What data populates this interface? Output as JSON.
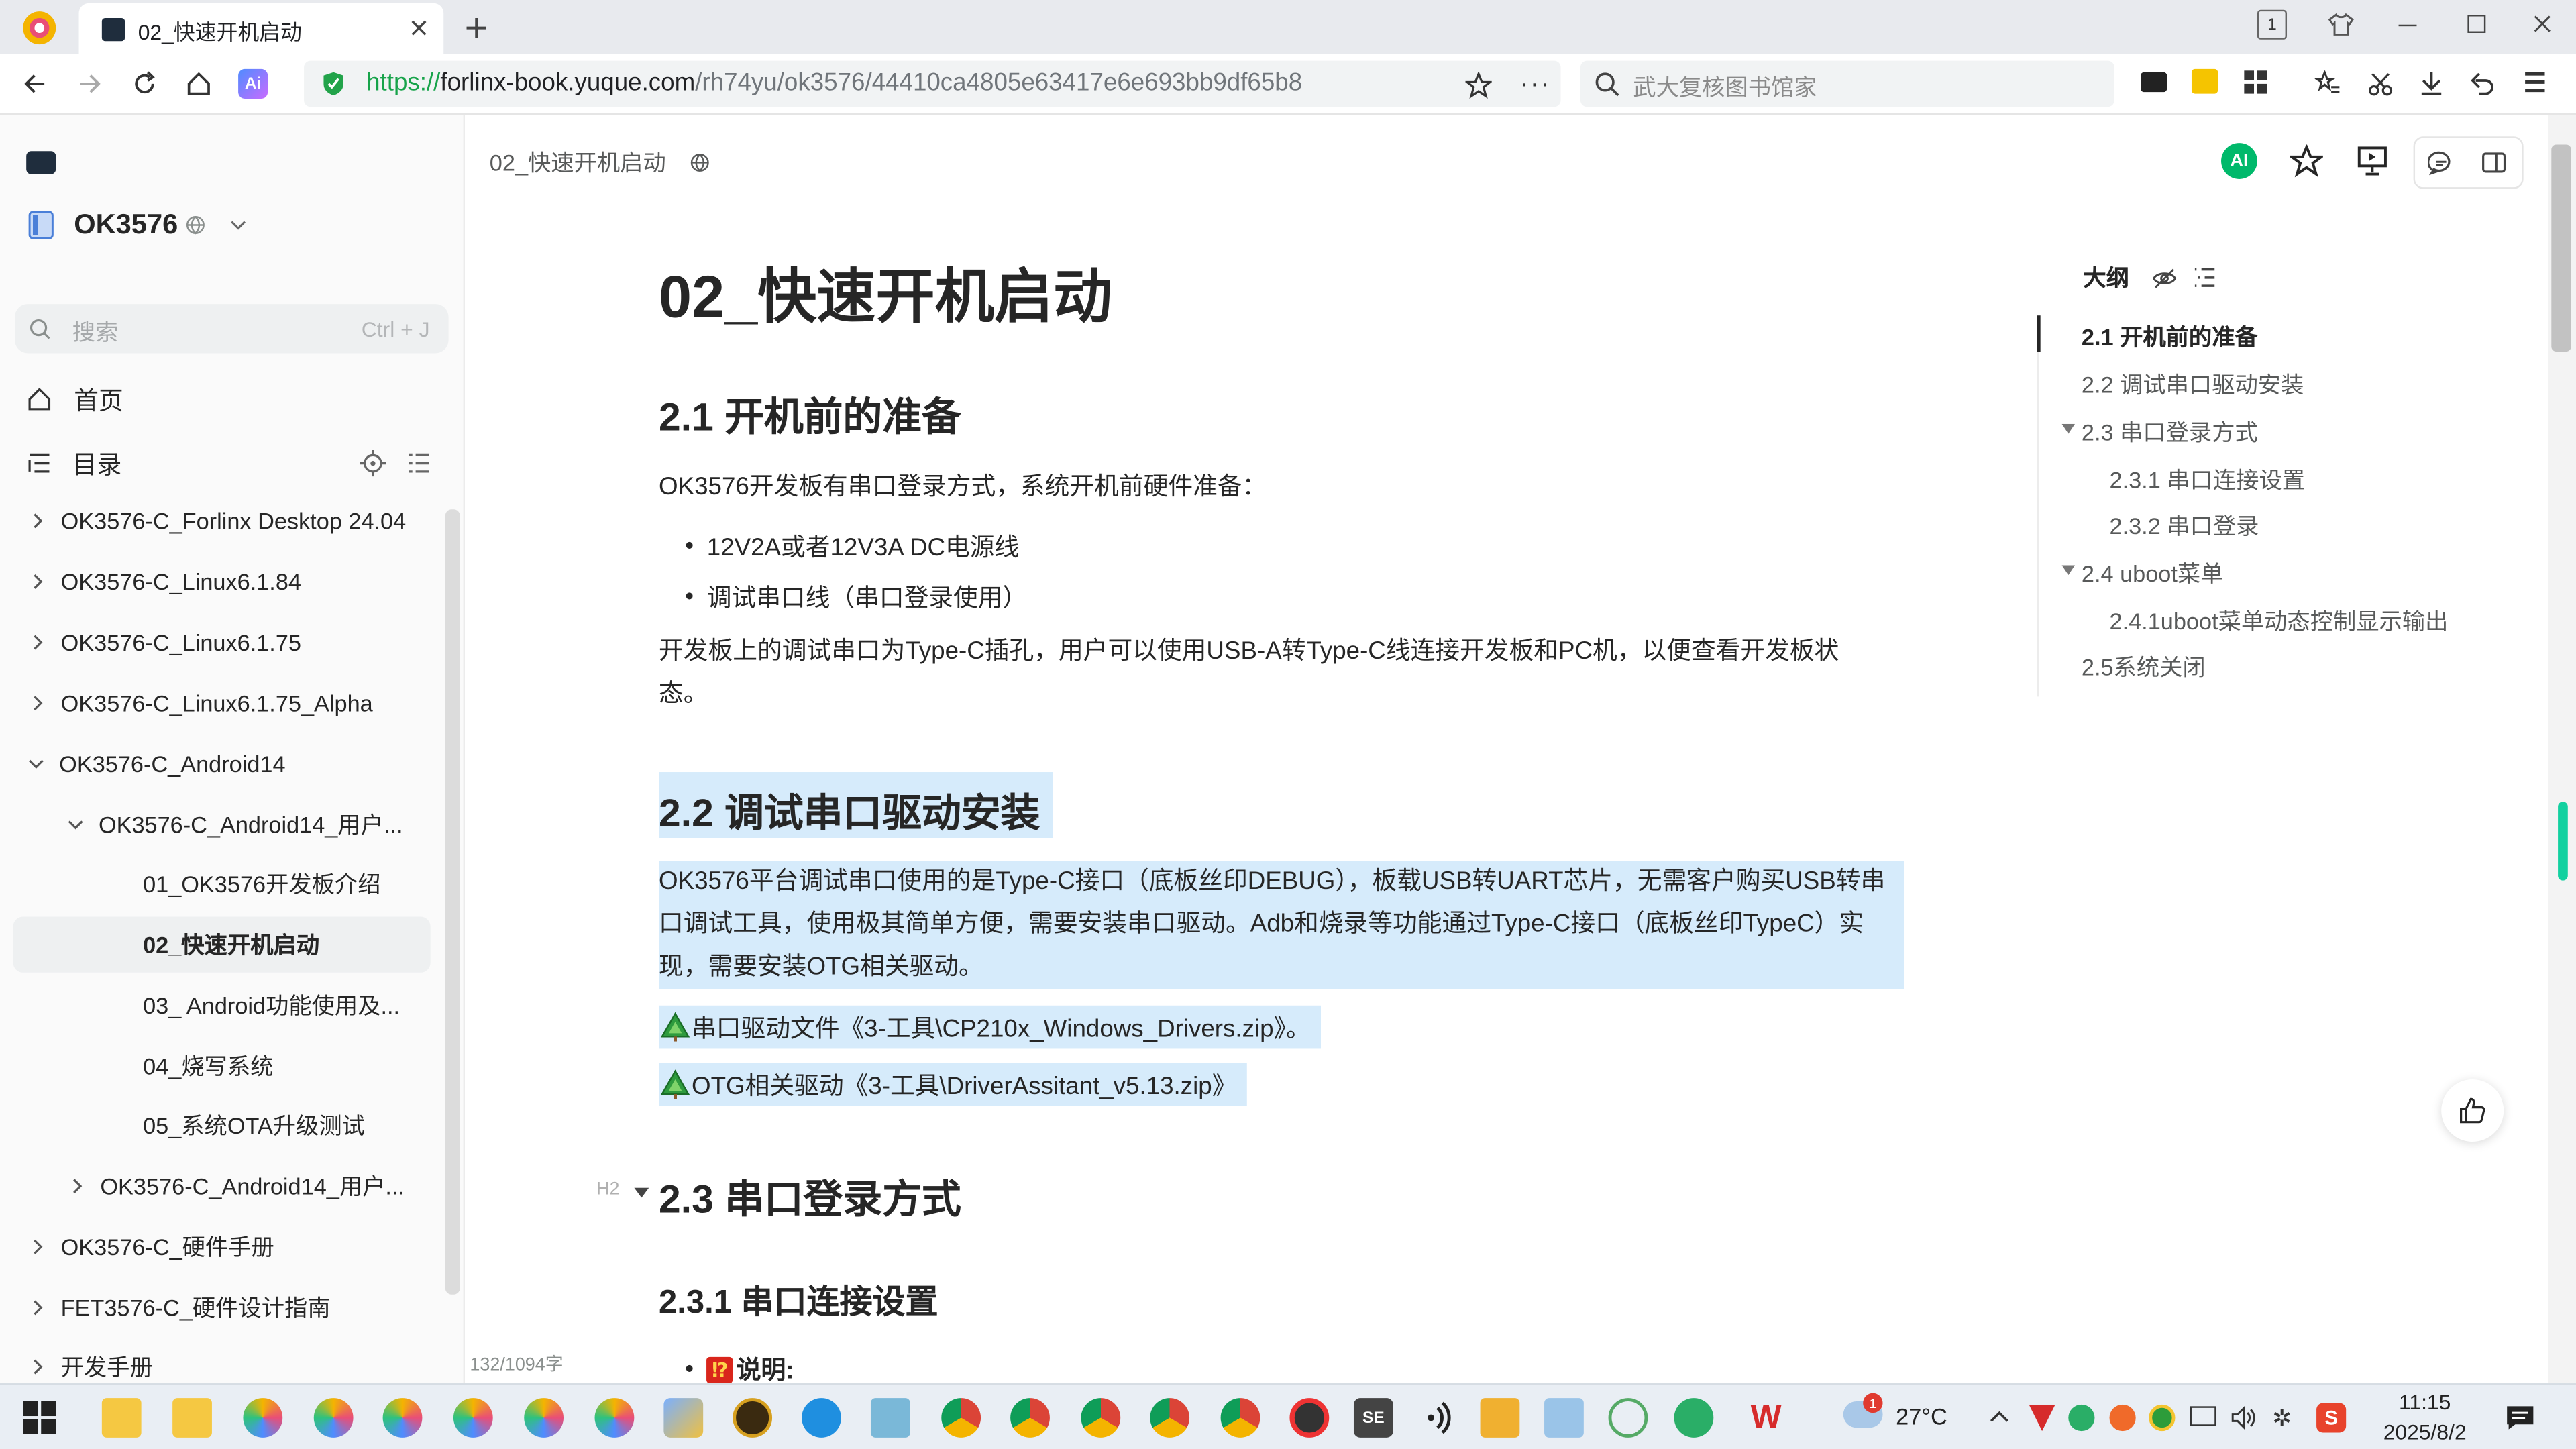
{
  "browser": {
    "tab_title": "02_快速开机启动",
    "url_prefix": "https://",
    "url_domain": "forlinx-book.yuque.com",
    "url_path": "/rh74yu/ok3576/44410ca4805e63417e6e693bb9df65b8",
    "search_placeholder": "武大复核图书馆家",
    "page_badge": "1"
  },
  "sidebar": {
    "book_title": "OK3576",
    "search_placeholder": "搜索",
    "search_shortcut": "Ctrl + J",
    "home_label": "首页",
    "catalog_label": "目录",
    "items": [
      {
        "label": "OK3576-C_Forlinx Desktop 24.04"
      },
      {
        "label": "OK3576-C_Linux6.1.84"
      },
      {
        "label": "OK3576-C_Linux6.1.75"
      },
      {
        "label": "OK3576-C_Linux6.1.75_Alpha"
      },
      {
        "label": "OK3576-C_Android14"
      },
      {
        "label": "OK3576-C_Android14_用户..."
      },
      {
        "label": "01_OK3576开发板介绍"
      },
      {
        "label": "02_快速开机启动"
      },
      {
        "label": "03_ Android功能使用及..."
      },
      {
        "label": "04_烧写系统"
      },
      {
        "label": "05_系统OTA升级测试"
      },
      {
        "label": "OK3576-C_Android14_用户..."
      },
      {
        "label": "OK3576-C_硬件手册"
      },
      {
        "label": "FET3576-C_硬件设计指南"
      },
      {
        "label": "开发手册"
      }
    ]
  },
  "doc": {
    "breadcrumb": "02_快速开机启动",
    "title": "02_快速开机启动",
    "h2_1": "2.1 开机前的准备",
    "p1": "OK3576开发板有串口登录方式，系统开机前硬件准备：",
    "bullets1": [
      "12V2A或者12V3A DC电源线",
      "调试串口线（串口登录使用）"
    ],
    "p2": "开发板上的调试串口为Type-C插孔，用户可以使用USB-A转Type-C线连接开发板和PC机，以便查看开发板状态。",
    "h2_2": "2.2 调试串口驱动安装",
    "p3": "OK3576平台调试串口使用的是Type-C接口（底板丝印DEBUG），板载USB转UART芯片，无需客户购买USB转串口调试工具，使用极其简单方便，需要安装串口驱动。Adb和烧录等功能通过Type-C接口（底板丝印TypeC）实现，需要安装OTG相关驱动。",
    "p4": "串口驱动文件《3-工具\\CP210x_Windows_Drivers.zip》。",
    "p5": "OTG相关驱动《3-工具\\DriverAssitant_v5.13.zip》",
    "h2_3": "2.3 串口登录方式",
    "h2_marker": "H2",
    "h3_1": "2.3.1 串口连接设置",
    "note": "说明:",
    "word_count": "132/1094字",
    "ai_label": "AI"
  },
  "toc": {
    "title": "大纲",
    "items": [
      {
        "label": "2.1 开机前的准备"
      },
      {
        "label": "2.2 调试串口驱动安装"
      },
      {
        "label": "2.3 串口登录方式"
      },
      {
        "label": "2.3.1 串口连接设置"
      },
      {
        "label": "2.3.2 串口登录"
      },
      {
        "label": "2.4 uboot菜单"
      },
      {
        "label": "2.4.1uboot菜单动态控制显示输出"
      },
      {
        "label": "2.5系统关闭"
      }
    ]
  },
  "taskbar": {
    "weather": "27°C",
    "time": "11:15",
    "date": "2025/8/2",
    "notify_count": "1"
  },
  "colors": {
    "accent": "#00b96b",
    "highlight": "#d6ebfb"
  }
}
